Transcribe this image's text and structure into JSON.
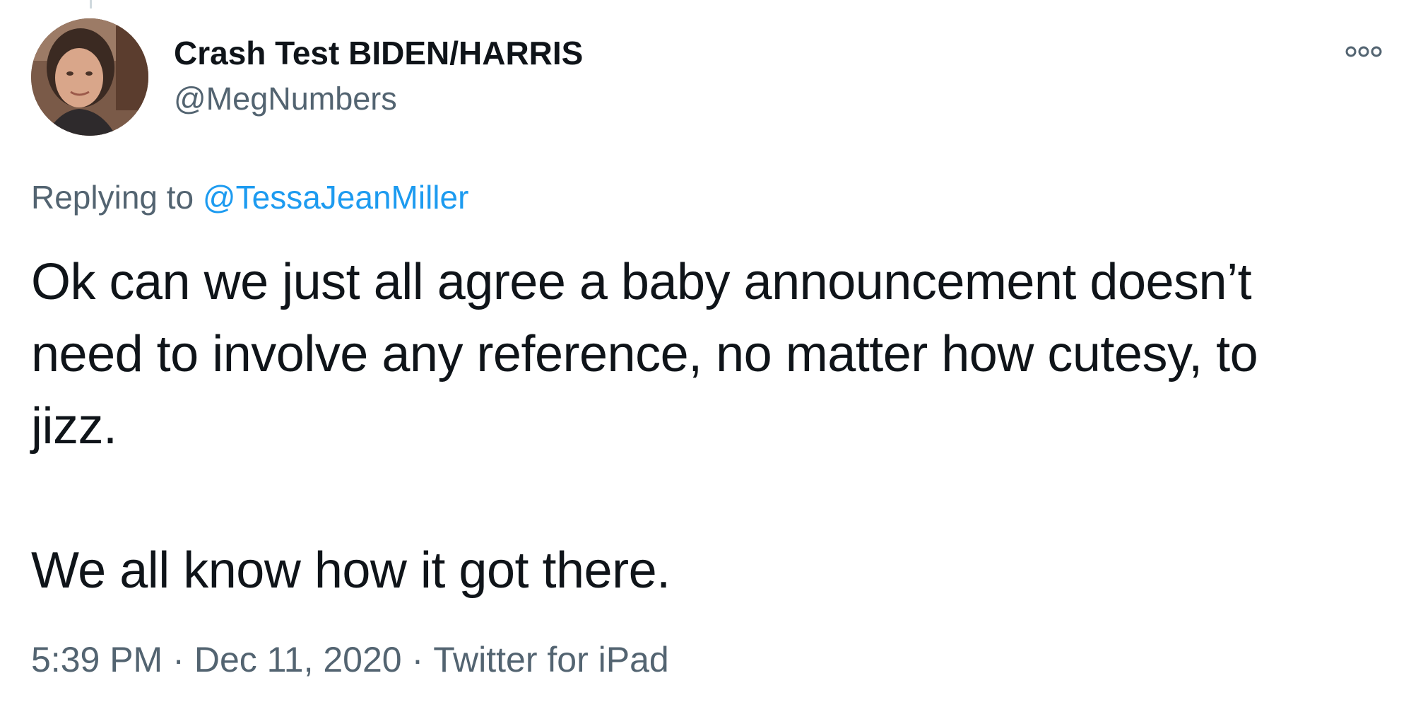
{
  "tweet": {
    "display_name": "Crash Test BIDEN/HARRIS",
    "handle": "@MegNumbers",
    "replying_prefix": "Replying to",
    "replying_to": "@TessaJeanMiller",
    "text_lines": [
      "Ok can we just all agree a baby announcement doesn’t",
      "need to involve any reference, no matter how cutesy, to",
      "jizz.",
      "We all know how it got there."
    ],
    "time": "5:39 PM",
    "date": "Dec 11, 2020",
    "source": "Twitter for iPad",
    "separator": "·"
  },
  "icons": {
    "more": "more-horizontal-icon",
    "avatar": "profile-photo"
  },
  "colors": {
    "primary_text": "#0f1419",
    "secondary_text": "#536471",
    "link": "#1d9bf0"
  }
}
